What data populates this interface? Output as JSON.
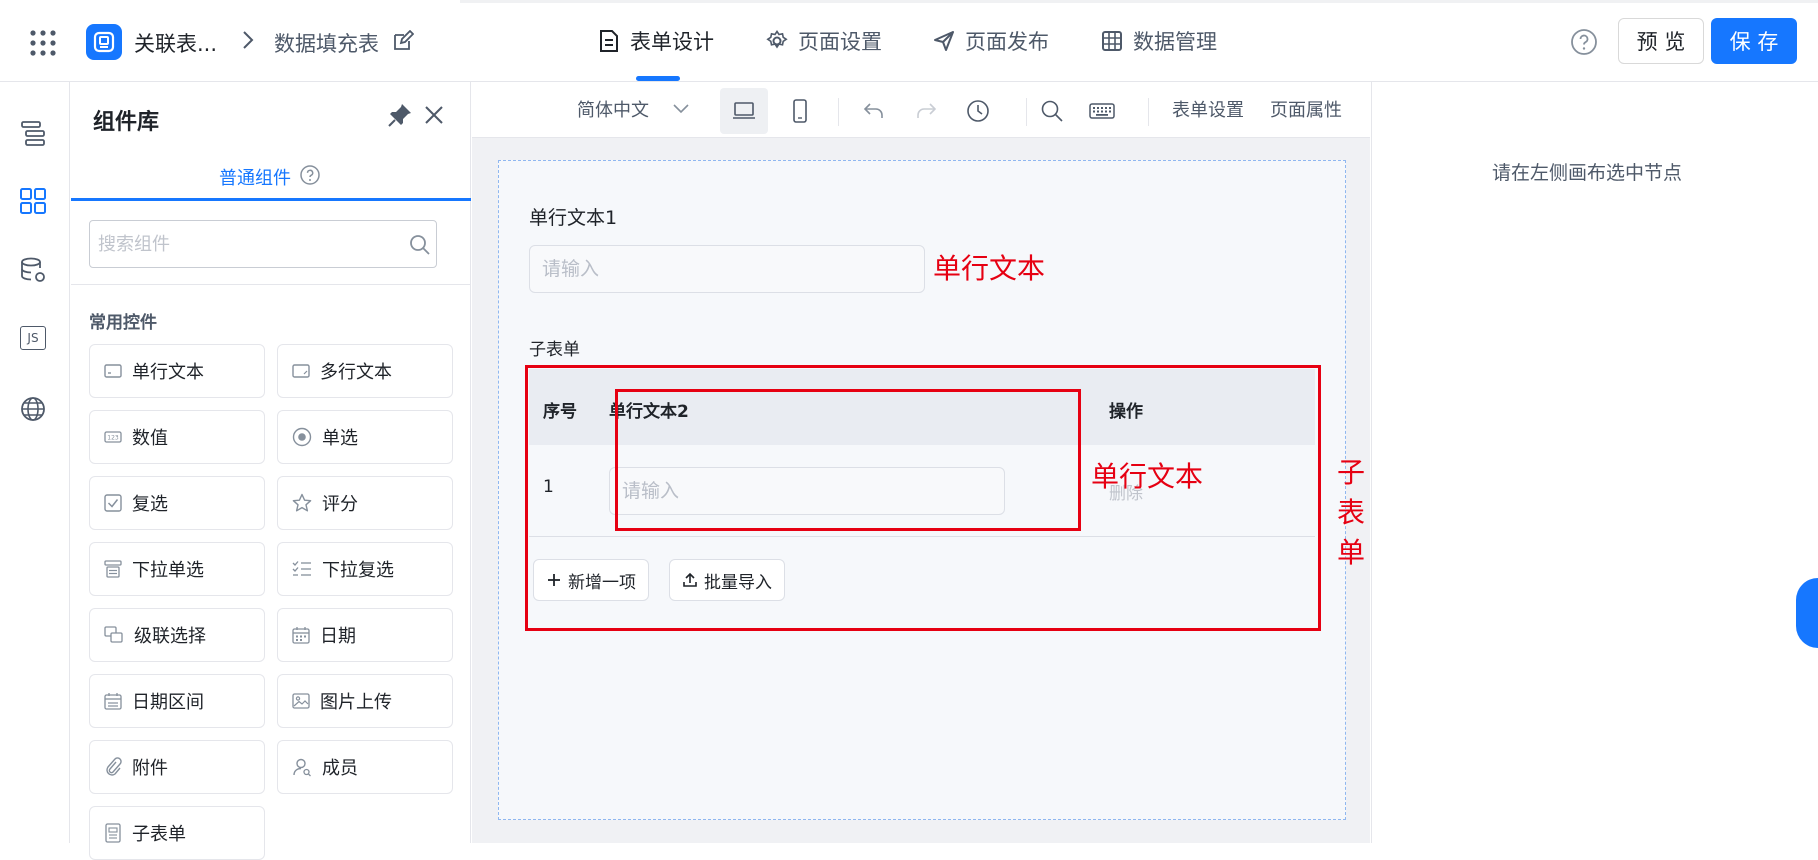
{
  "header": {
    "app_name": "关联表...",
    "page_name": "数据填充表",
    "tabs": [
      {
        "label": "表单设计",
        "icon": "document-icon"
      },
      {
        "label": "页面设置",
        "icon": "gear-icon"
      },
      {
        "label": "页面发布",
        "icon": "send-icon"
      },
      {
        "label": "数据管理",
        "icon": "grid-icon"
      }
    ],
    "active_tab": "表单设计",
    "preview_label": "预 览",
    "save_label": "保 存",
    "accent_color": "#1677ff"
  },
  "rail": {
    "items": [
      {
        "icon": "outline-icon"
      },
      {
        "icon": "components-icon"
      },
      {
        "icon": "datasource-icon"
      },
      {
        "icon": "js-icon",
        "label": "JS"
      },
      {
        "icon": "globe-icon"
      }
    ]
  },
  "panel": {
    "title": "组件库",
    "tab_label": "普通组件",
    "search_placeholder": "搜索组件",
    "section_title": "常用控件",
    "components": [
      {
        "label": "单行文本",
        "icon": "single-line-text-icon"
      },
      {
        "label": "多行文本",
        "icon": "multi-line-text-icon"
      },
      {
        "label": "数值",
        "icon": "number-icon",
        "icon_text": "123"
      },
      {
        "label": "单选",
        "icon": "radio-icon"
      },
      {
        "label": "复选",
        "icon": "checkbox-icon"
      },
      {
        "label": "评分",
        "icon": "star-icon"
      },
      {
        "label": "下拉单选",
        "icon": "dropdown-single-icon"
      },
      {
        "label": "下拉复选",
        "icon": "dropdown-multi-icon"
      },
      {
        "label": "级联选择",
        "icon": "cascade-icon"
      },
      {
        "label": "日期",
        "icon": "calendar-icon"
      },
      {
        "label": "日期区间",
        "icon": "date-range-icon"
      },
      {
        "label": "图片上传",
        "icon": "image-upload-icon"
      },
      {
        "label": "附件",
        "icon": "paperclip-icon"
      },
      {
        "label": "成员",
        "icon": "member-icon"
      },
      {
        "label": "子表单",
        "icon": "subform-icon"
      }
    ]
  },
  "toolbar": {
    "language": "简体中文",
    "form_settings": "表单设置",
    "page_properties": "页面属性"
  },
  "canvas": {
    "field1_label": "单行文本1",
    "field1_placeholder": "请输入",
    "subform_label": "子表单",
    "subform_columns": [
      "序号",
      "单行文本2",
      "操作"
    ],
    "subform_rows": [
      {
        "index": "1",
        "placeholder": "请输入",
        "action": "删除"
      }
    ],
    "add_button": "新增一项",
    "import_button": "批量导入"
  },
  "annotations": {
    "single_text_1": "单行文本",
    "single_text_2": "单行文本",
    "subform": "子表单",
    "color": "#e60012"
  },
  "right_panel": {
    "empty_text": "请在左侧画布选中节点"
  }
}
